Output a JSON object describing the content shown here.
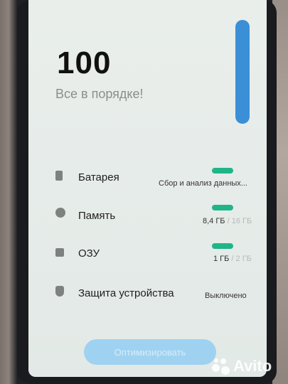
{
  "score": "100",
  "status": "Все в порядке!",
  "rows": [
    {
      "label": "Батарея",
      "value": "Сбор и анализ данных...",
      "icon": "battery-icon",
      "level": 1.0
    },
    {
      "label": "Память",
      "value_main": "8,4 ГБ",
      "value_sep": " / 16 ГБ",
      "icon": "storage-pie-icon",
      "level": 1.0
    },
    {
      "label": "ОЗУ",
      "value_main": "1 ГБ",
      "value_sep": " / 2 ГБ",
      "icon": "ram-chip-icon",
      "level": 1.0
    },
    {
      "label": "Защита устройства",
      "value": "Выключено",
      "icon": "shield-icon"
    }
  ],
  "optimize_button": "Оптимизировать",
  "watermark": "Avito",
  "colors": {
    "accent": "#1fb588",
    "button": "#9fd2f1",
    "scroll": "#3b8fd6"
  }
}
